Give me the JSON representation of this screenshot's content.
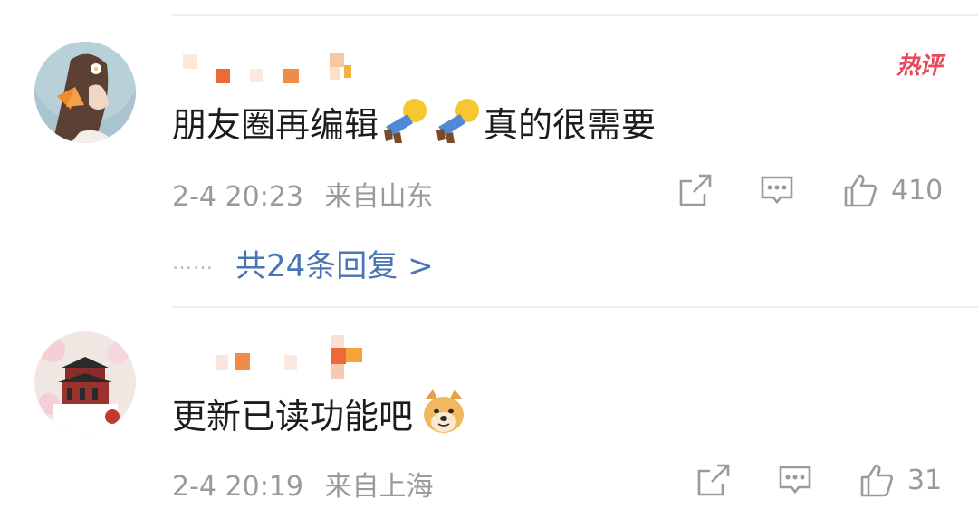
{
  "comments": [
    {
      "text_parts": [
        "朋友圈再编辑",
        "真的很需要"
      ],
      "emojis": [
        "pushing-hands-emoji",
        "pushing-hands-emoji"
      ],
      "timestamp": "2-4 20:23",
      "location": "来自山东",
      "likes": "410",
      "hot_badge": "热评",
      "replies_label": "共24条回复 >",
      "replies_dots": "……",
      "avatar": "girl-with-orange-bow-avatar"
    },
    {
      "text": "更新已读功能吧",
      "emoji": "doge-emoji",
      "timestamp": "2-4 20:19",
      "location": "来自上海",
      "likes": "31",
      "avatar": "palace-and-blossoms-avatar"
    }
  ],
  "icons": {
    "share": "share-icon",
    "comment": "comment-icon",
    "like": "thumbs-up-icon"
  },
  "colors": {
    "reply_link": "#4a74b5",
    "hot_badge": "#e8495a",
    "meta_text": "#9a9a9a",
    "divider": "#ededed"
  }
}
